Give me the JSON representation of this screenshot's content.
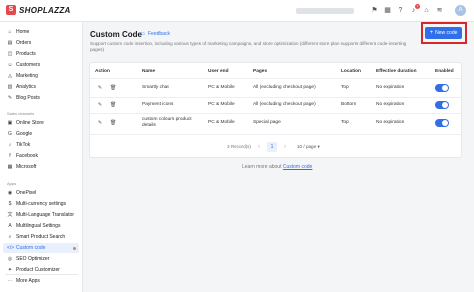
{
  "app": {
    "logo_text": "SHOPLAZZA",
    "store_name": "",
    "avatar_initial": "A",
    "notification_count": "1"
  },
  "sidebar": {
    "items": [
      {
        "label": "Home",
        "icon": "home-icon",
        "glyph": "⌂"
      },
      {
        "label": "Orders",
        "icon": "orders-icon",
        "glyph": "▤"
      },
      {
        "label": "Products",
        "icon": "products-icon",
        "glyph": "◫"
      },
      {
        "label": "Customers",
        "icon": "customers-icon",
        "glyph": "☺"
      },
      {
        "label": "Marketing",
        "icon": "marketing-icon",
        "glyph": "◬"
      },
      {
        "label": "Analytics",
        "icon": "analytics-icon",
        "glyph": "▥"
      },
      {
        "label": "Blog Posts",
        "icon": "blog-icon",
        "glyph": "✎"
      }
    ],
    "sales_channels_heading": "Sales channels",
    "channels": [
      {
        "label": "Online Store",
        "icon": "store-icon",
        "glyph": "▣"
      },
      {
        "label": "Google",
        "icon": "google-icon",
        "glyph": "G"
      },
      {
        "label": "TikTok",
        "icon": "tiktok-icon",
        "glyph": "♪"
      },
      {
        "label": "Facebook",
        "icon": "facebook-icon",
        "glyph": "f"
      },
      {
        "label": "Microsoft",
        "icon": "microsoft-icon",
        "glyph": "▦"
      }
    ],
    "apps_heading": "Apps",
    "apps": [
      {
        "label": "OnePixel",
        "icon": "onepixel-icon",
        "glyph": "◉"
      },
      {
        "label": "Multi-currency settings",
        "icon": "currency-icon",
        "glyph": "$"
      },
      {
        "label": "Multi-Language Translator",
        "icon": "translator-icon",
        "glyph": "文"
      },
      {
        "label": "Multilingual Settings",
        "icon": "language-icon",
        "glyph": "A"
      },
      {
        "label": "Smart Product Search",
        "icon": "search-icon",
        "glyph": "⌕"
      },
      {
        "label": "Custom code",
        "icon": "code-icon",
        "glyph": "</>"
      },
      {
        "label": "SEO Optimizer",
        "icon": "seo-icon",
        "glyph": "◎"
      },
      {
        "label": "Product Customizer",
        "icon": "customizer-icon",
        "glyph": "✦"
      }
    ],
    "more_apps": "More Apps"
  },
  "header": {
    "title": "Custom Code",
    "feedback": "Feedback",
    "description": "Support custom code insertion, including various types of marketing campaigns, and store optimization (different store plan supports different code-inserting pages)",
    "new_button": "New code"
  },
  "table": {
    "columns": [
      "Action",
      "Name",
      "User end",
      "Pages",
      "Location",
      "Effective duration",
      "Enabled"
    ],
    "rows": [
      {
        "name": "Smartly chat",
        "user_end": "PC & Mobile",
        "pages": "All (excluding checkout page)",
        "location": "Top",
        "duration": "No expiration",
        "enabled": true
      },
      {
        "name": "Payment icons",
        "user_end": "PC & Mobile",
        "pages": "All (excluding checkout page)",
        "location": "Bottom",
        "duration": "No expiration",
        "enabled": true
      },
      {
        "name": "custom colours product details",
        "user_end": "PC & Mobile",
        "pages": "Special page",
        "location": "Top",
        "duration": "No expiration",
        "enabled": true
      }
    ]
  },
  "pagination": {
    "total": "3 Record(s)",
    "current": "1",
    "page_size": "10 / page"
  },
  "footer": {
    "learn_prefix": "Learn more about",
    "learn_link": "Custom code"
  },
  "colors": {
    "accent": "#2f6fe8",
    "highlight": "#d62828",
    "brand": "#e5484d"
  }
}
